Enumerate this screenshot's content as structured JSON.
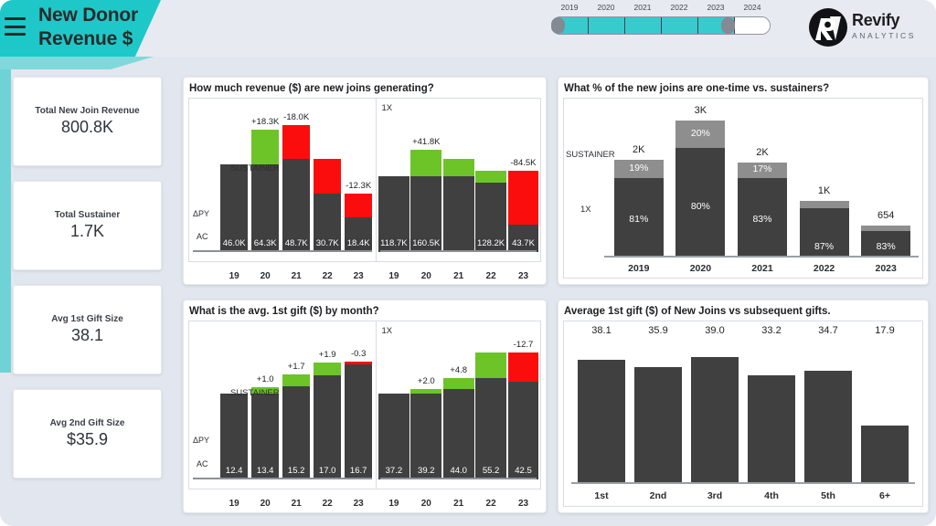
{
  "header": {
    "title_line1": "New Donor",
    "title_line2": "Revenue $",
    "menu_icon": "hamburger-menu-icon",
    "logo_name": "Revify",
    "logo_sub": "ANALYTICS",
    "accent_color": "#1ec8c8"
  },
  "year_slider": {
    "years": [
      "2019",
      "2020",
      "2021",
      "2022",
      "2023",
      "2024"
    ],
    "selected": [
      "2019",
      "2020",
      "2021",
      "2022",
      "2023"
    ],
    "unselected": [
      "2024"
    ]
  },
  "kpis": [
    {
      "label": "Total New Join Revenue",
      "value": "800.8K"
    },
    {
      "label": "Total Sustainer",
      "value": "1.7K"
    },
    {
      "label": "Avg 1st Gift Size",
      "value": "38.1"
    },
    {
      "label": "Avg 2nd Gift Size",
      "value": "$35.9"
    }
  ],
  "chart_data": [
    {
      "id": "revenue-new-joins",
      "type": "bar",
      "title": "How much revenue ($) are new joins generating?",
      "panel_labels": {
        "left": "SUSTAINER",
        "right": "1X"
      },
      "row_labels": {
        "delta": "ΔPY",
        "actual": "AC"
      },
      "categories": [
        "19",
        "20",
        "21",
        "22",
        "23"
      ],
      "panels": [
        {
          "name": "SUSTAINER",
          "values": [
            46.0,
            64.3,
            48.7,
            30.7,
            18.4
          ],
          "value_labels": [
            "46.0K",
            "64.3K",
            "48.7K",
            "30.7K",
            "18.4K"
          ],
          "deltas": [
            null,
            18.3,
            -18.0,
            -18.0,
            -12.3
          ],
          "delta_labels": [
            null,
            "+18.3K",
            "-18.0K",
            null,
            "-12.3K"
          ],
          "ymax": 70
        },
        {
          "name": "1X",
          "values": [
            118.7,
            160.5,
            146.5,
            128.2,
            43.7
          ],
          "value_labels": [
            "118.7K",
            "160.5K",
            null,
            "128.2K",
            "43.7K"
          ],
          "deltas": [
            null,
            41.8,
            27.8,
            18.3,
            -84.5
          ],
          "delta_labels": [
            null,
            "+41.8K",
            null,
            null,
            "-84.5K"
          ],
          "ymax": 210
        }
      ],
      "colors": {
        "actual": "#404040",
        "positive": "#6cc428",
        "negative": "#fc0d0d"
      }
    },
    {
      "id": "one-time-vs-sustainers",
      "type": "bar",
      "stacked": true,
      "title": "What % of the new joins are one-time vs. sustainers?",
      "categories": [
        "2019",
        "2020",
        "2021",
        "2022",
        "2023"
      ],
      "totals": [
        "2K",
        "3K",
        "2K",
        "1K",
        "654"
      ],
      "total_values": [
        2000,
        2800,
        1950,
        1150,
        654
      ],
      "row_labels": {
        "sustainer": "SUSTAINER",
        "onetime": "1X"
      },
      "series": [
        {
          "name": "SUSTAINER",
          "values": [
            19,
            20,
            17,
            13,
            17
          ],
          "labels": [
            "19%",
            "20%",
            "17%",
            null,
            null
          ],
          "color": "#8e8e8e"
        },
        {
          "name": "1X",
          "values": [
            81,
            80,
            83,
            87,
            83
          ],
          "labels": [
            "81%",
            "80%",
            "83%",
            "87%",
            "83%"
          ],
          "color": "#404040"
        }
      ]
    },
    {
      "id": "avg-first-gift-by-month",
      "type": "bar",
      "title": "What is the avg. 1st gift ($) by month?",
      "panel_labels": {
        "left": "SUSTAINER",
        "right": "1X"
      },
      "row_labels": {
        "delta": "ΔPY",
        "actual": "AC"
      },
      "categories": [
        "19",
        "20",
        "21",
        "22",
        "23"
      ],
      "panels": [
        {
          "name": "SUSTAINER",
          "values": [
            12.4,
            13.4,
            15.2,
            17.0,
            16.7
          ],
          "value_labels": [
            "12.4",
            "13.4",
            "15.2",
            "17.0",
            "16.7"
          ],
          "deltas": [
            null,
            1.0,
            1.7,
            1.9,
            -0.3
          ],
          "delta_labels": [
            null,
            "+1.0",
            "+1.7",
            "+1.9",
            "-0.3"
          ],
          "ymax": 20
        },
        {
          "name": "1X",
          "values": [
            37.2,
            39.2,
            44.0,
            55.2,
            42.5
          ],
          "value_labels": [
            "37.2",
            "39.2",
            "44.0",
            "55.2",
            "42.5"
          ],
          "deltas": [
            null,
            2.0,
            4.8,
            11.2,
            -12.7
          ],
          "delta_labels": [
            null,
            "+2.0",
            "+4.8",
            null,
            "-12.7"
          ],
          "ymax": 60
        }
      ],
      "colors": {
        "actual": "#404040",
        "positive": "#6cc428",
        "negative": "#fc0d0d"
      }
    },
    {
      "id": "first-gift-vs-subsequent",
      "type": "bar",
      "title": "Average 1st gift ($) of New Joins vs subsequent gifts.",
      "categories": [
        "1st",
        "2nd",
        "3rd",
        "4th",
        "5th",
        "6+"
      ],
      "values": [
        38.1,
        35.9,
        39.0,
        33.2,
        34.7,
        17.9
      ],
      "value_labels": [
        "38.1",
        "35.9",
        "39.0",
        "33.2",
        "34.7",
        "17.9"
      ],
      "ylim": [
        0,
        42
      ],
      "color": "#404040"
    }
  ]
}
